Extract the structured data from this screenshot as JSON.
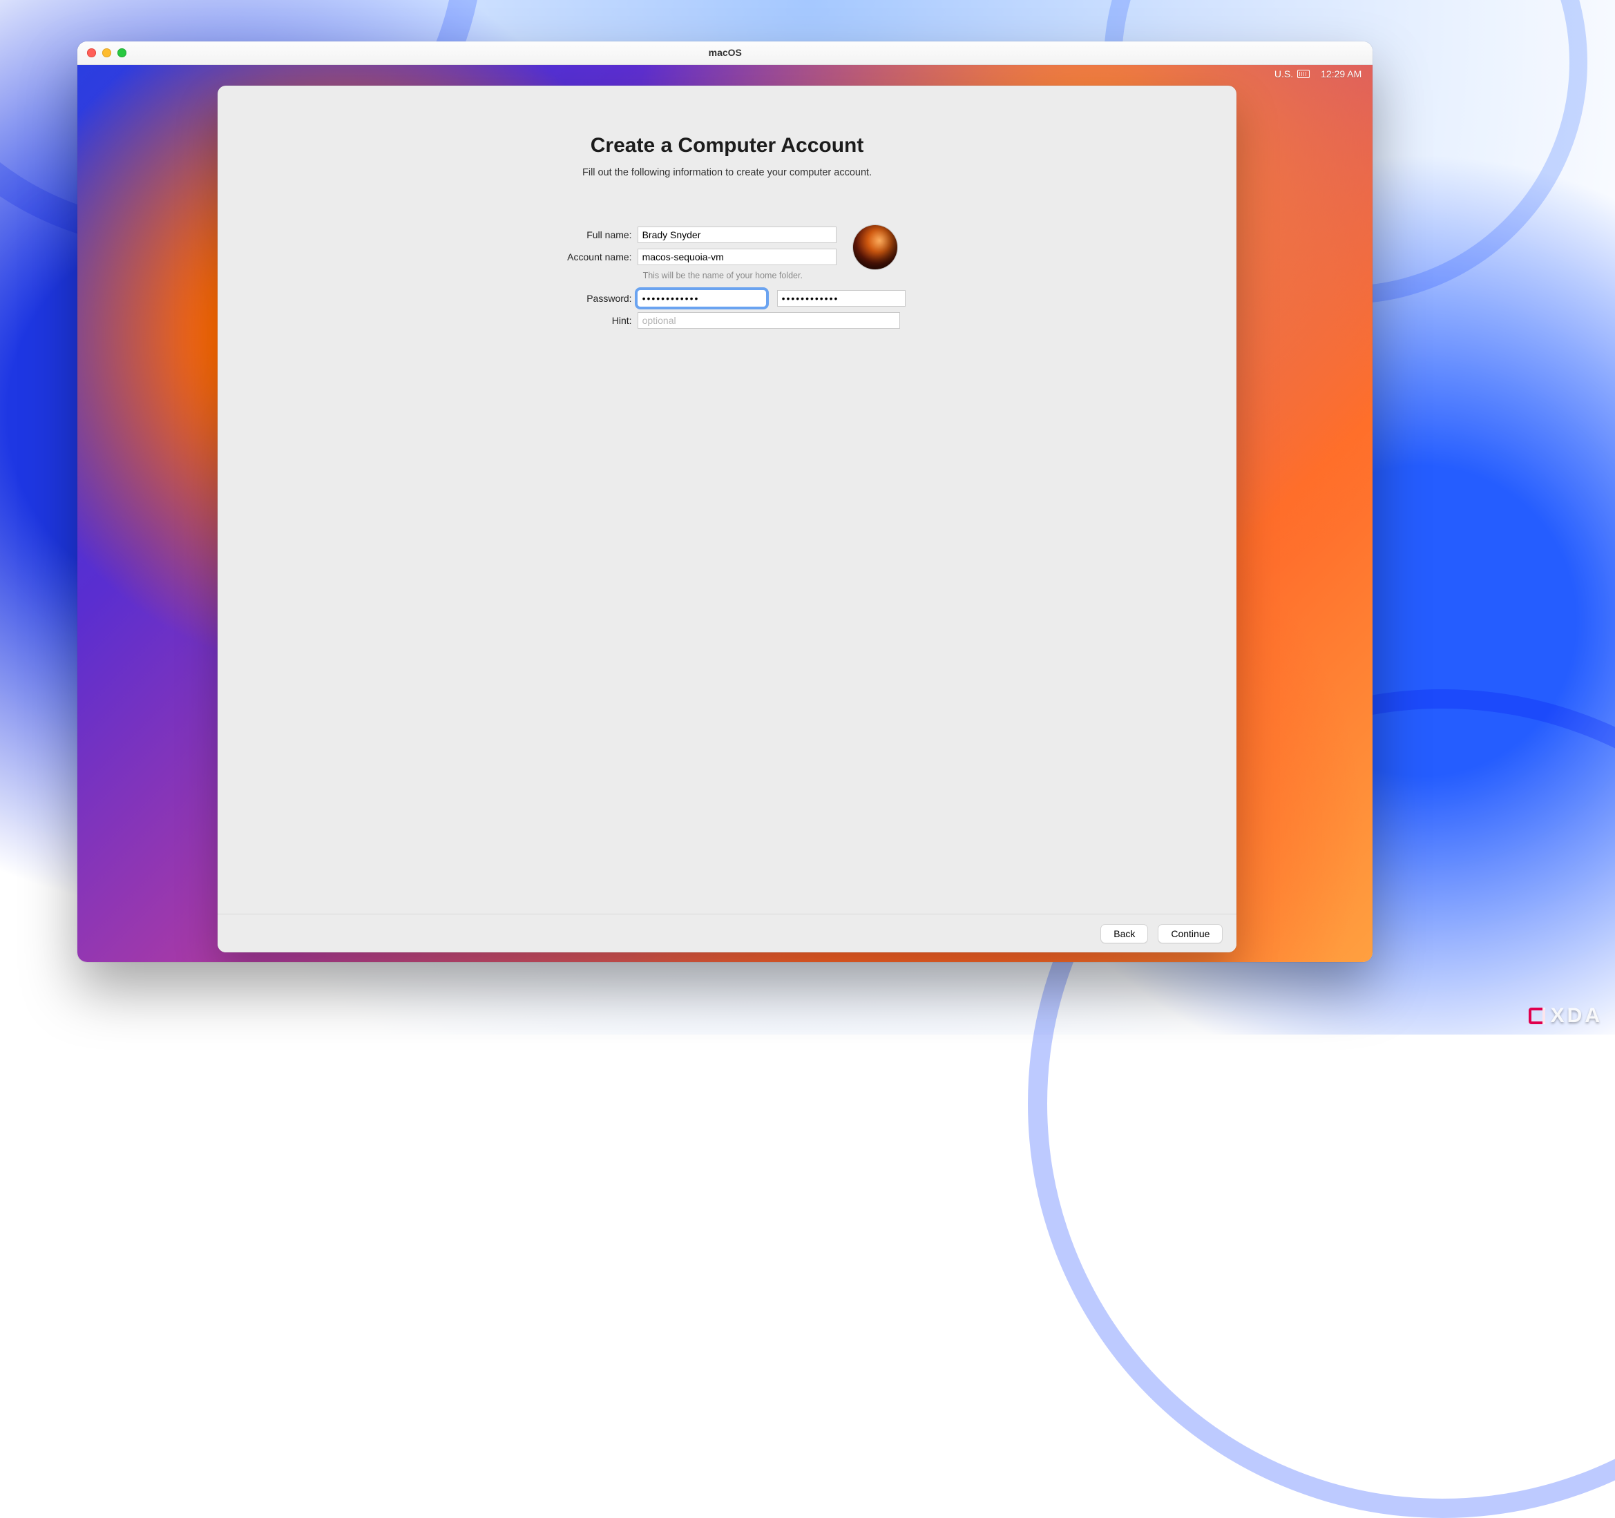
{
  "window": {
    "title": "macOS"
  },
  "menubar": {
    "input_source": "U.S.",
    "clock": "12:29 AM"
  },
  "assistant": {
    "title": "Create a Computer Account",
    "subtitle": "Fill out the following information to create your computer account.",
    "labels": {
      "full_name": "Full name:",
      "account_name": "Account name:",
      "password": "Password:",
      "hint": "Hint:"
    },
    "values": {
      "full_name": "Brady Snyder",
      "account_name": "macos-sequoia-vm",
      "password": "••••••••••••",
      "password_verify": "••••••••••••",
      "hint": ""
    },
    "placeholders": {
      "hint": "optional"
    },
    "helper_account": "This will be the name of your home folder.",
    "buttons": {
      "back": "Back",
      "continue": "Continue"
    }
  },
  "watermark": "XDA"
}
